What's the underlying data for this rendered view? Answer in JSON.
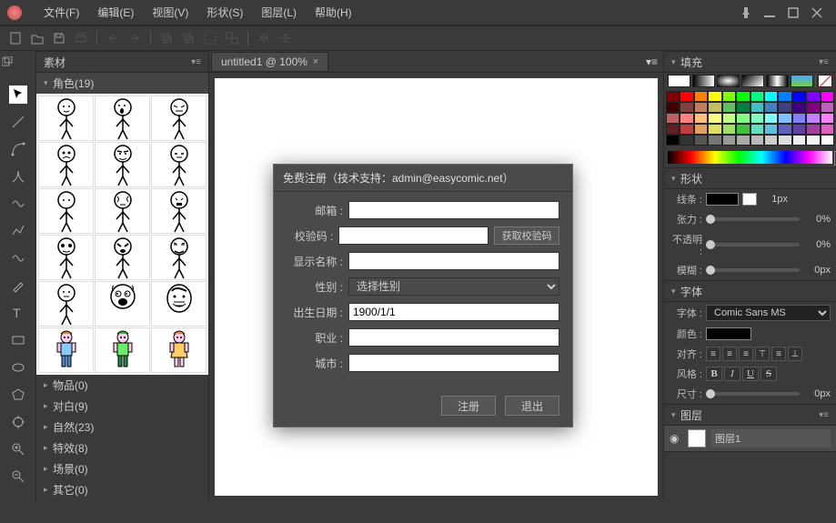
{
  "menu": {
    "file": "文件(F)",
    "edit": "编辑(E)",
    "view": "视图(V)",
    "shape": "形状(S)",
    "layer": "图层(L)",
    "help": "帮助(H)"
  },
  "panels": {
    "materials": "素材",
    "fill": "填充",
    "shape": "形状",
    "font": "字体",
    "layer": "图层"
  },
  "materials_tree": {
    "character": {
      "label": "角色",
      "count": "(19)"
    },
    "item": {
      "label": "物品",
      "count": "(0)"
    },
    "dialogue": {
      "label": "对白",
      "count": "(9)"
    },
    "nature": {
      "label": "自然",
      "count": "(23)"
    },
    "effect": {
      "label": "特效",
      "count": "(8)"
    },
    "scene": {
      "label": "场景",
      "count": "(0)"
    },
    "other": {
      "label": "其它",
      "count": "(0)"
    }
  },
  "canvas": {
    "tab": "untitled1 @ 100%"
  },
  "shape_props": {
    "line_label": "线条 :",
    "line_val": "1px",
    "tension_label": "张力 :",
    "tension_val": "0%",
    "opacity_label": "不透明 :",
    "opacity_val": "0%",
    "blur_label": "模糊 :",
    "blur_val": "0px"
  },
  "font_props": {
    "font_label": "字体 :",
    "font_val": "Comic Sans MS",
    "color_label": "颜色 :",
    "align_label": "对齐 :",
    "style_label": "风格 :",
    "size_label": "尺寸 :",
    "size_val": "0px"
  },
  "layer": {
    "name": "图层1"
  },
  "palette": [
    "#800000",
    "#ff0000",
    "#ff8000",
    "#ffff00",
    "#80ff00",
    "#00ff00",
    "#00ff80",
    "#00ffff",
    "#0080ff",
    "#0000ff",
    "#8000ff",
    "#ff00ff",
    "#400000",
    "#804040",
    "#c08060",
    "#c0c060",
    "#60c060",
    "#008040",
    "#40c0c0",
    "#4080c0",
    "#404080",
    "#400080",
    "#800080",
    "#c060c0",
    "#c06060",
    "#ff8080",
    "#ffc080",
    "#ffff80",
    "#c0ff80",
    "#80ff80",
    "#80ffc0",
    "#80ffff",
    "#80c0ff",
    "#8080ff",
    "#c080ff",
    "#ff80ff",
    "#602020",
    "#c04040",
    "#e0a060",
    "#e0e060",
    "#a0e060",
    "#40c040",
    "#60e0c0",
    "#60c0e0",
    "#6060c0",
    "#6040a0",
    "#a040a0",
    "#e060c0",
    "#000000",
    "#333333",
    "#555555",
    "#777777",
    "#999999",
    "#aaaaaa",
    "#bbbbbb",
    "#cccccc",
    "#dddddd",
    "#eeeeee",
    "#f5f5f5",
    "#ffffff"
  ],
  "dialog": {
    "title": "免费注册（技术支持：admin@easycomic.net）",
    "email_label": "邮箱 :",
    "code_label": "校验码 :",
    "code_btn": "获取校验码",
    "display_label": "显示名称 :",
    "gender_label": "性别 :",
    "gender_placeholder": "选择性别",
    "birth_label": "出生日期 :",
    "birth_val": "1900/1/1",
    "job_label": "职业 :",
    "city_label": "城市 :",
    "register_btn": "注册",
    "exit_btn": "退出"
  }
}
